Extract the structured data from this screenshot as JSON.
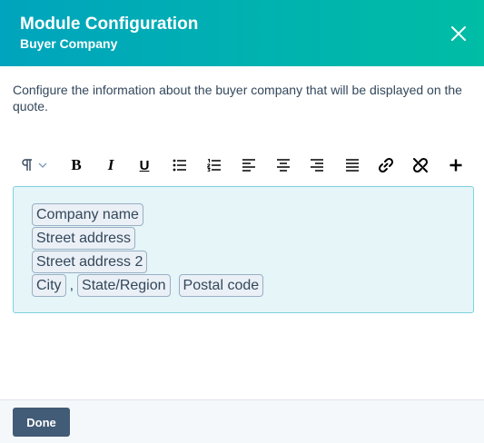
{
  "header": {
    "title": "Module Configuration",
    "subtitle": "Buyer Company",
    "close_icon": "close-icon"
  },
  "description": "Configure the information about the buyer company that will be displayed on the quote.",
  "toolbar": {
    "items": [
      "paragraph-style-dropdown",
      "bold",
      "italic",
      "underline",
      "bulleted-list",
      "numbered-list",
      "align-left",
      "align-center",
      "align-right",
      "justify",
      "insert-link",
      "remove-link",
      "insert-more"
    ],
    "bold_label": "B",
    "italic_label": "I",
    "underline_label": "U"
  },
  "editor": {
    "lines": [
      [
        "Company name"
      ],
      [
        "Street address"
      ],
      [
        "Street address 2"
      ],
      [
        "City",
        "State/Region",
        "Postal code"
      ]
    ],
    "comma": ","
  },
  "footer": {
    "done_label": "Done"
  },
  "colors": {
    "header_gradient_start": "#00a4bd",
    "header_gradient_end": "#00bda5",
    "editor_bg": "#e5f5f8",
    "button_bg": "#425b76"
  }
}
